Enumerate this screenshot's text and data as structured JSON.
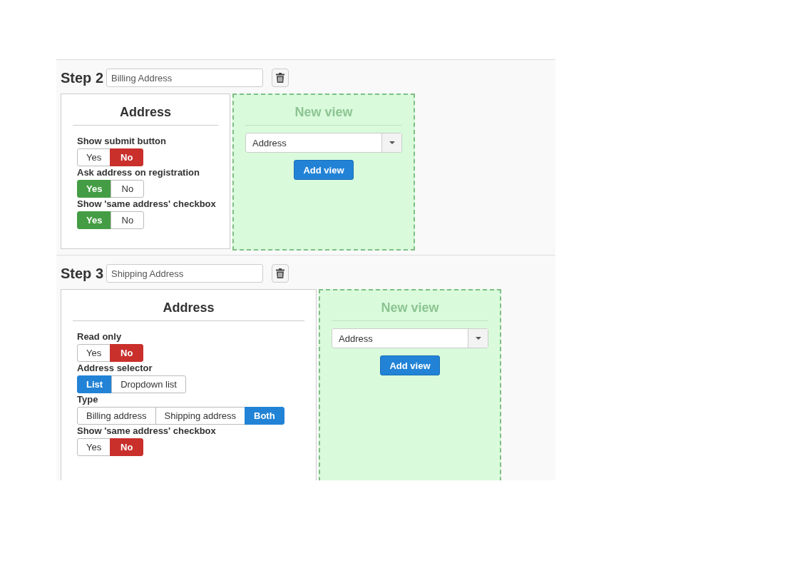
{
  "steps": [
    {
      "label": "Step 2",
      "name": "Billing Address",
      "card": {
        "title": "Address",
        "wide": false,
        "options": [
          {
            "label": "Show submit button",
            "choices": [
              {
                "label": "Yes",
                "selected": false
              },
              {
                "label": "No",
                "selected": true,
                "color": "#c9302c"
              }
            ]
          },
          {
            "label": "Ask address on registration",
            "choices": [
              {
                "label": "Yes",
                "selected": true,
                "color": "#449d44"
              },
              {
                "label": "No",
                "selected": false
              }
            ]
          },
          {
            "label": "Show 'same address' checkbox",
            "choices": [
              {
                "label": "Yes",
                "selected": true,
                "color": "#449d44"
              },
              {
                "label": "No",
                "selected": false
              }
            ]
          }
        ]
      },
      "new_view": {
        "title": "New view",
        "select": "Address",
        "button": "Add view"
      }
    },
    {
      "label": "Step 3",
      "name": "Shipping Address",
      "card": {
        "title": "Address",
        "wide": true,
        "options": [
          {
            "label": "Read only",
            "choices": [
              {
                "label": "Yes",
                "selected": false
              },
              {
                "label": "No",
                "selected": true,
                "color": "#c9302c"
              }
            ]
          },
          {
            "label": "Address selector",
            "choices": [
              {
                "label": "List",
                "selected": true,
                "color": "#2283d6"
              },
              {
                "label": "Dropdown list",
                "selected": false
              }
            ]
          },
          {
            "label": "Type",
            "choices": [
              {
                "label": "Billing address",
                "selected": false
              },
              {
                "label": "Shipping address",
                "selected": false
              },
              {
                "label": "Both",
                "selected": true,
                "color": "#2283d6"
              }
            ]
          },
          {
            "label": "Show 'same address' checkbox",
            "choices": [
              {
                "label": "Yes",
                "selected": false
              },
              {
                "label": "No",
                "selected": true,
                "color": "#c9302c"
              }
            ]
          }
        ]
      },
      "new_view": {
        "title": "New view",
        "select": "Address",
        "button": "Add view"
      }
    }
  ]
}
